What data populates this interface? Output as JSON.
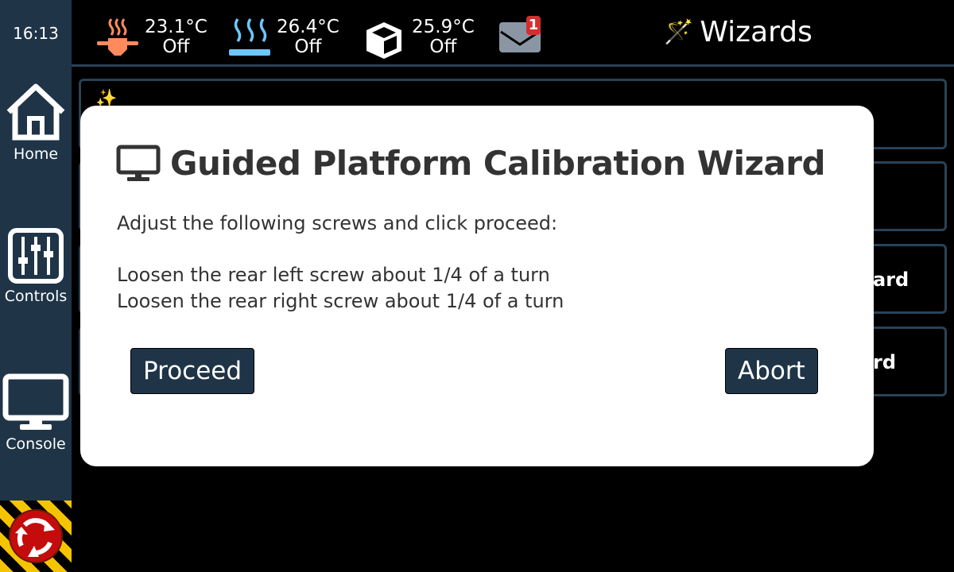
{
  "sidebar": {
    "clock": "16:13",
    "items": [
      {
        "label": "Home",
        "icon": "home-icon"
      },
      {
        "label": "Controls",
        "icon": "sliders-icon"
      },
      {
        "label": "Console",
        "icon": "monitor-icon"
      }
    ],
    "emergency_stop_icon": "emergency-stop-icon"
  },
  "topbar": {
    "extruder": {
      "temp": "23.1°C",
      "target": "Off",
      "color": "#ff8a5c"
    },
    "bed": {
      "temp": "26.4°C",
      "target": "Off",
      "color": "#6ec6ff"
    },
    "chamber": {
      "temp": "25.9°C",
      "target": "Off"
    },
    "notifications": {
      "count": "1"
    },
    "title": "Wizards"
  },
  "background_cards": [
    {
      "fragment": ""
    },
    {
      "fragment": ""
    },
    {
      "fragment": "ard"
    },
    {
      "fragment": "rd"
    }
  ],
  "modal": {
    "title": "Guided Platform Calibration Wizard",
    "intro": "Adjust the following screws and click proceed:",
    "steps": [
      "Loosen the rear left screw about 1/4 of a turn",
      "Loosen the rear right screw about 1/4 of a turn"
    ],
    "proceed_label": "Proceed",
    "abort_label": "Abort"
  }
}
